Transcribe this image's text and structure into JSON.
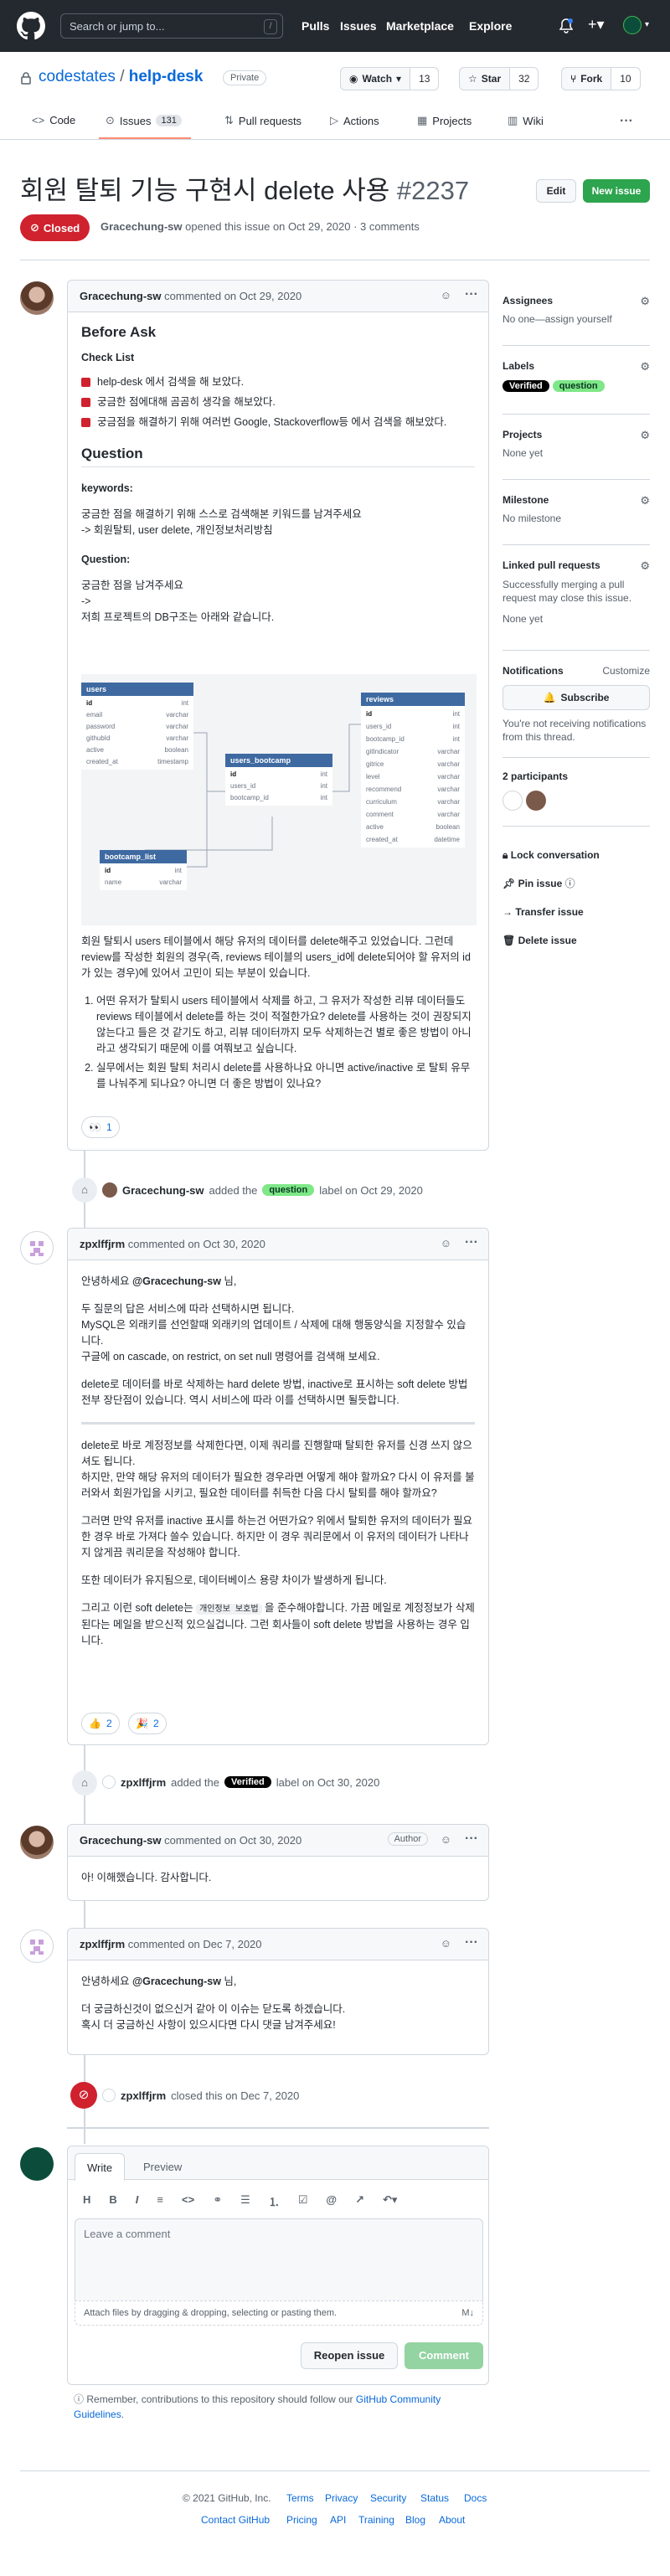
{
  "header": {
    "search_placeholder": "Search or jump to...",
    "slash": "/",
    "nav": [
      "Pulls",
      "Issues",
      "Marketplace",
      "Explore"
    ]
  },
  "repo": {
    "owner": "codestates",
    "sep": "/",
    "name": "help-desk",
    "visibility": "Private",
    "watch_label": "Watch",
    "watch_count": "13",
    "star_label": "Star",
    "star_count": "32",
    "fork_label": "Fork",
    "fork_count": "10"
  },
  "tabs": {
    "code": "Code",
    "issues": "Issues",
    "issues_count": "131",
    "pulls": "Pull requests",
    "actions": "Actions",
    "projects": "Projects",
    "wiki": "Wiki"
  },
  "issue": {
    "title": "회원 탈퇴 기능 구현시 delete 사용",
    "number": "#2237",
    "edit": "Edit",
    "new_issue": "New issue",
    "state": "Closed",
    "opened_by": "Gracechung-sw",
    "opened_text": "opened this issue on Oct 29, 2020 · 3 comments"
  },
  "c1": {
    "author": "Gracechung-sw",
    "meta": "commented on Oct 29, 2020",
    "h_before": "Before Ask",
    "checklist_title": "Check List",
    "checks": [
      "help-desk 에서 검색을 해 보았다.",
      "궁금한 점에대해 곰곰히 생각을 해보았다.",
      "궁금점을 해결하기 위해 여러번 Google, Stackoverflow등 에서 검색을 해보았다."
    ],
    "h_question": "Question",
    "kw_title": "keywords:",
    "kw_lines": [
      "궁금한 점을 해결하기 위해 스스로 검색해본 키워드를 남겨주세요",
      "-> 회원탈퇴, user delete, 개인정보처리방침"
    ],
    "q_title": "Question:",
    "q_lines": [
      "궁금한 점을 남겨주세요",
      "->",
      "저희 프로젝트의 DB구조는 아래와 같습니다."
    ],
    "p1": "회원 탈퇴시 users 테이블에서 해당 유저의 데이터를 delete해주고 있었습니다. 그런데 review를 작성한 회원의 경우(즉, reviews 테이블의 users_id에 delete되어야 할 유저의 id가 있는 경우)에 있어서 고민이 되는 부분이 있습니다.",
    "li1": "어떤 유저가 탈퇴시 users 테이블에서 삭제를 하고, 그 유저가 작성한 리뷰 데이터들도 reviews 테이블에서 delete를 하는 것이 적절한가요? delete를 사용하는 것이 권장되지 않는다고 들은 것 같기도 하고, 리뷰 데이터까지 모두 삭제하는건 별로 좋은 방법이 아니라고 생각되기 때문에 이를 여쭤보고 싶습니다.",
    "li2": "실무에서는 회원 탈퇴 처리시 delete를 사용하나요 아니면 active/inactive 로 탈퇴 유무를 나눠주게 되나요? 아니면 더 좋은 방법이 있나요?",
    "reaction_count": "1"
  },
  "erd": {
    "users": {
      "title": "users",
      "rows": [
        [
          "id",
          "int"
        ],
        [
          "email",
          "varchar"
        ],
        [
          "password",
          "varchar"
        ],
        [
          "githubId",
          "varchar"
        ],
        [
          "active",
          "boolean"
        ],
        [
          "created_at",
          "timestamp"
        ]
      ]
    },
    "bootcamp": {
      "title": "users_bootcamp",
      "rows": [
        [
          "id",
          "int"
        ],
        [
          "users_id",
          "int"
        ],
        [
          "bootcamp_id",
          "int"
        ]
      ]
    },
    "reviews": {
      "title": "reviews",
      "rows": [
        [
          "id",
          "int"
        ],
        [
          "users_id",
          "int"
        ],
        [
          "bootcamp_id",
          "int"
        ],
        [
          "gitIndicator",
          "varchar"
        ],
        [
          "gitrice",
          "varchar"
        ],
        [
          "level",
          "varchar"
        ],
        [
          "recommend",
          "varchar"
        ],
        [
          "curriculum",
          "varchar"
        ],
        [
          "comment",
          "varchar"
        ],
        [
          "active",
          "boolean"
        ],
        [
          "created_at",
          "datetime"
        ]
      ]
    },
    "list": {
      "title": "bootcamp_list",
      "rows": [
        [
          "id",
          "int"
        ],
        [
          "name",
          "varchar"
        ]
      ]
    }
  },
  "ev1": {
    "actor": "Gracechung-sw",
    "pre": "added the",
    "label": "question",
    "post": "label on Oct 29, 2020"
  },
  "c2": {
    "author": "zpxlffjrm",
    "meta": "commented on Oct 30, 2020",
    "greet_pre": "안녕하세요 ",
    "mention": "@Gracechung-sw",
    "greet_post": " 님,",
    "lines": [
      "두 질문의 답은 서비스에 따라 선택하시면 됩니다.",
      "MySQL은 외래키를 선언할때 외래키의 업데이트 / 삭제에 대해 행동양식을 지정할수 있습니다.",
      "구글에 on cascade, on restrict, on set null 명령어를 검색해 보세요."
    ],
    "p2": "delete로 데이터를 바로 삭제하는 hard delete 방법, inactive로 표시하는 soft delete 방법 전부 장단점이 있습니다. 역시 서비스에 따라 이를 선택하시면 될듯합니다.",
    "p3": "delete로 바로 계정정보를 삭제한다면, 이제 쿼리를 진행할때 탈퇴한 유저를 신경 쓰지 않으셔도 됩니다.",
    "p4": "하지만, 만약 해당 유저의 데이터가 필요한 경우라면 어떻게 해야 할까요? 다시 이 유저를 불러와서 회원가입을 시키고, 필요한 데이터를 취득한 다음 다시 탈퇴를 해야 할까요?",
    "p5": "그러면 만약 유저를 inactive 표시를 하는건 어떤가요? 위에서 탈퇴한 유저의 데이터가 필요한 경우 바로 가져다 쓸수 있습니다. 하지만 이 경우 쿼리문에서 이 유저의 데이터가 나타나지 않게끔 쿼리문을 작성해야 합니다.",
    "p6": "또한 데이터가 유지됨으로, 데이터베이스 용량 차이가 발생하게 됩니다.",
    "p7_pre": "그리고 이런 soft delete는 ",
    "p7_code": "개인정보 보호법",
    "p7_post": " 을 준수해야합니다. 가끔 메일로 계정정보가 삭제된다는 메일을 받으신적 있으실겁니다. 그런 회사들이 soft delete 방법을 사용하는 경우 입니다.",
    "r_thumb": "2",
    "r_tada": "2"
  },
  "ev2": {
    "actor": "zpxlffjrm",
    "pre": "added the",
    "label": "Verified",
    "post": "label on Oct 30, 2020"
  },
  "c3": {
    "author": "Gracechung-sw",
    "meta": "commented on Oct 30, 2020",
    "badge": "Author",
    "body": "아! 이해했습니다. 감사합니다."
  },
  "c4": {
    "author": "zpxlffjrm",
    "meta": "commented on Dec 7, 2020",
    "greet_pre": "안녕하세요 ",
    "mention": "@Gracechung-sw",
    "greet_post": " 님,",
    "l1": "더 궁금하신것이 없으신거 같아 이 이슈는 닫도록 하겠습니다.",
    "l2": "혹시 더 궁금하신 사항이 있으시다면 다시 댓글 남겨주세요!"
  },
  "ev3": {
    "actor": "zpxlffjrm",
    "text": "closed this on Dec 7, 2020"
  },
  "composer": {
    "tab_write": "Write",
    "tab_preview": "Preview",
    "placeholder": "Leave a comment",
    "attach": "Attach files by dragging & dropping, selecting or pasting them.",
    "reopen": "Reopen issue",
    "comment": "Comment",
    "remember_pre": "Remember, contributions to this repository should follow our ",
    "remember_link": "GitHub Community Guidelines",
    "remember_post": "."
  },
  "sidebar": {
    "assignees": "Assignees",
    "assignees_val": "No one—assign yourself",
    "labels": "Labels",
    "label1": "Verified",
    "label2": "question",
    "projects": "Projects",
    "projects_val": "None yet",
    "milestone": "Milestone",
    "milestone_val": "No milestone",
    "linked": "Linked pull requests",
    "linked_desc": "Successfully merging a pull request may close this issue.",
    "linked_val": "None yet",
    "notifications": "Notifications",
    "customize": "Customize",
    "subscribe": "Subscribe",
    "notif_desc": "You're not receiving notifications from this thread.",
    "participants": "2 participants",
    "lock": "Lock conversation",
    "pin": "Pin issue",
    "transfer": "Transfer issue",
    "delete": "Delete issue"
  },
  "footer": {
    "copyright": "© 2021 GitHub, Inc.",
    "row1": [
      "Terms",
      "Privacy",
      "Security",
      "Status",
      "Docs"
    ],
    "row2": [
      "Contact GitHub",
      "Pricing",
      "API",
      "Training",
      "Blog",
      "About"
    ]
  },
  "colors": {
    "closed": "#cf222e",
    "green": "#2da44e",
    "verified": "#000000",
    "question": "#7ee787",
    "link": "#0969da"
  }
}
